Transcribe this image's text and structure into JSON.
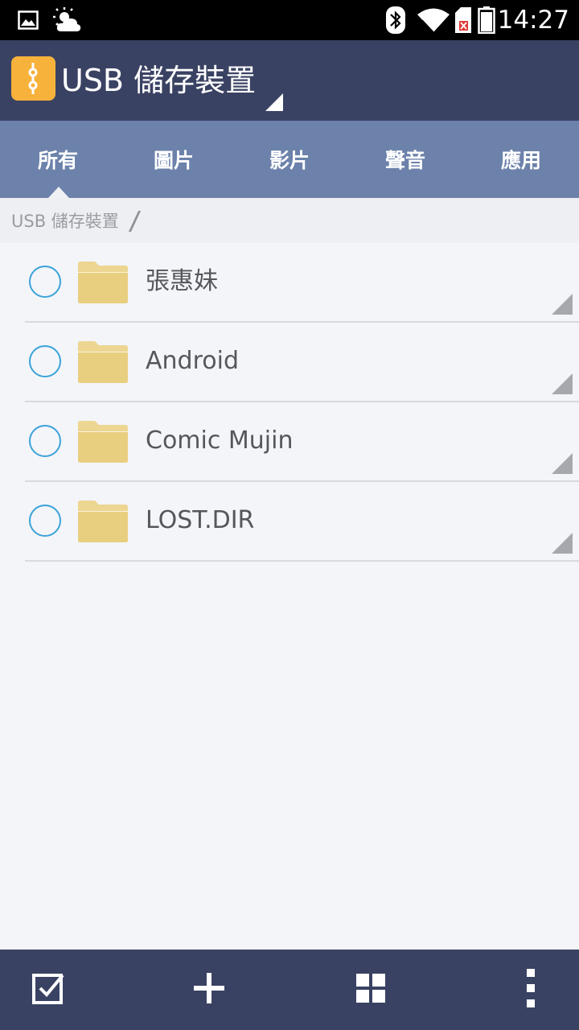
{
  "status_bar": {
    "time": "14:27",
    "icons": [
      "image-notification-icon",
      "weather-icon",
      "bluetooth-icon",
      "wifi-icon",
      "no-sim-icon",
      "battery-icon"
    ]
  },
  "app_bar": {
    "title": "USB 儲存裝置",
    "logo_color": "#f7b23b",
    "background": "#3a4263"
  },
  "tabs": [
    {
      "label": "所有",
      "selected": true
    },
    {
      "label": "圖片",
      "selected": false
    },
    {
      "label": "影片",
      "selected": false
    },
    {
      "label": "聲音",
      "selected": false
    },
    {
      "label": "應用",
      "selected": false
    }
  ],
  "breadcrumb": {
    "path": "USB 儲存裝置"
  },
  "files": [
    {
      "name": "張惠妹",
      "type": "folder"
    },
    {
      "name": "Android",
      "type": "folder"
    },
    {
      "name": "Comic Mujin",
      "type": "folder"
    },
    {
      "name": "LOST.DIR",
      "type": "folder"
    }
  ],
  "bottom_bar": {
    "buttons": [
      "select-all-icon",
      "add-icon",
      "grid-view-icon",
      "more-vert-icon"
    ]
  },
  "colors": {
    "accent_blue": "#3aa3d8",
    "tab_bar": "#6c82ab",
    "folder": "#e9d286"
  }
}
